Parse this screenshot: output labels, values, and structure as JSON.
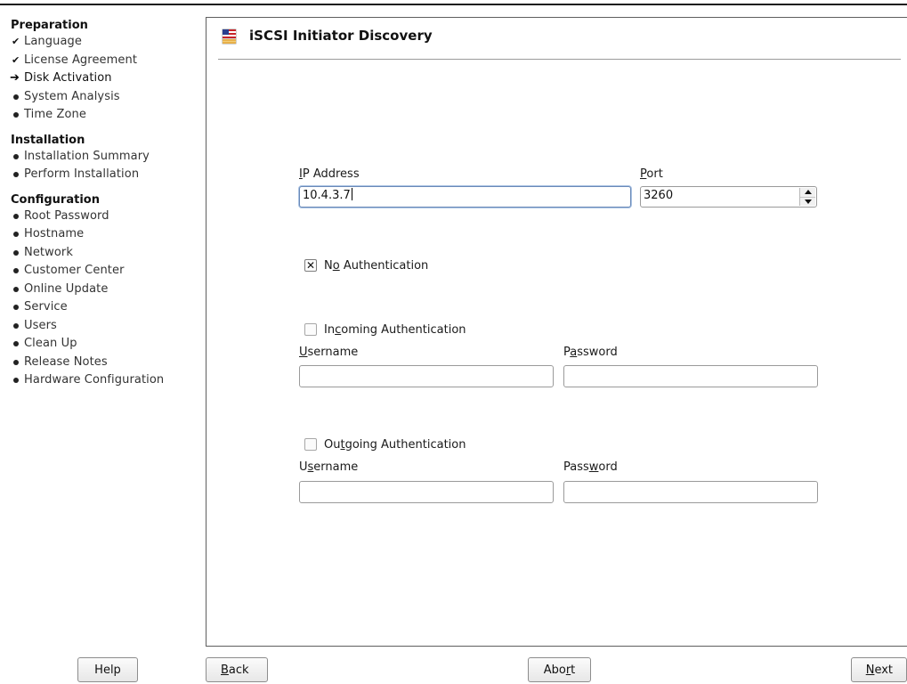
{
  "colors": {
    "border": "#5f5f5f",
    "focus_border": "#6a8ab8",
    "text": "#1a1a1a",
    "background": "#ffffff"
  },
  "sidebar": {
    "groups": [
      {
        "heading": "Preparation",
        "items": [
          {
            "label": "Language",
            "status": "done",
            "icon": "check-icon"
          },
          {
            "label": "License Agreement",
            "status": "done",
            "icon": "check-icon"
          },
          {
            "label": "Disk Activation",
            "status": "current",
            "icon": "arrow-right-icon"
          },
          {
            "label": "System Analysis",
            "status": "pending",
            "icon": "bullet-icon"
          },
          {
            "label": "Time Zone",
            "status": "pending",
            "icon": "bullet-icon"
          }
        ]
      },
      {
        "heading": "Installation",
        "items": [
          {
            "label": "Installation Summary",
            "status": "pending",
            "icon": "bullet-icon"
          },
          {
            "label": "Perform Installation",
            "status": "pending",
            "icon": "bullet-icon"
          }
        ]
      },
      {
        "heading": "Configuration",
        "items": [
          {
            "label": "Root Password",
            "status": "pending",
            "icon": "bullet-icon"
          },
          {
            "label": "Hostname",
            "status": "pending",
            "icon": "bullet-icon"
          },
          {
            "label": "Network",
            "status": "pending",
            "icon": "bullet-icon"
          },
          {
            "label": "Customer Center",
            "status": "pending",
            "icon": "bullet-icon"
          },
          {
            "label": "Online Update",
            "status": "pending",
            "icon": "bullet-icon"
          },
          {
            "label": "Service",
            "status": "pending",
            "icon": "bullet-icon"
          },
          {
            "label": "Users",
            "status": "pending",
            "icon": "bullet-icon"
          },
          {
            "label": "Clean Up",
            "status": "pending",
            "icon": "bullet-icon"
          },
          {
            "label": "Release Notes",
            "status": "pending",
            "icon": "bullet-icon"
          },
          {
            "label": "Hardware Configuration",
            "status": "pending",
            "icon": "bullet-icon"
          }
        ]
      }
    ]
  },
  "main": {
    "title": "iSCSI Initiator Discovery",
    "title_icon": "flag-icon",
    "ip_address": {
      "label_prefix": "",
      "label_mnemonic": "I",
      "label_suffix": "P Address",
      "value": "10.4.3.7"
    },
    "port": {
      "label_prefix": "",
      "label_mnemonic": "P",
      "label_suffix": "ort",
      "value": "3260"
    },
    "no_auth": {
      "label_prefix": "N",
      "label_mnemonic": "o",
      "label_suffix": " Authentication",
      "checked": true
    },
    "incoming_auth": {
      "label_prefix": "In",
      "label_mnemonic": "c",
      "label_suffix": "oming Authentication",
      "checked": false,
      "username": {
        "label_prefix": "",
        "label_mnemonic": "U",
        "label_suffix": "sername",
        "value": ""
      },
      "password": {
        "label_prefix": "P",
        "label_mnemonic": "a",
        "label_suffix": "ssword",
        "value": ""
      }
    },
    "outgoing_auth": {
      "label_prefix": "Ou",
      "label_mnemonic": "t",
      "label_suffix": "going Authentication",
      "checked": false,
      "username": {
        "label_prefix": "U",
        "label_mnemonic": "s",
        "label_suffix": "ername",
        "value": ""
      },
      "password": {
        "label_prefix": "Pass",
        "label_mnemonic": "w",
        "label_suffix": "ord",
        "value": ""
      }
    }
  },
  "buttons": {
    "help": {
      "label": "Help"
    },
    "back": {
      "prefix": "",
      "mnemonic": "B",
      "suffix": "ack"
    },
    "abort": {
      "prefix": "Abo",
      "mnemonic": "r",
      "suffix": "t"
    },
    "next": {
      "prefix": "",
      "mnemonic": "N",
      "suffix": "ext"
    }
  }
}
